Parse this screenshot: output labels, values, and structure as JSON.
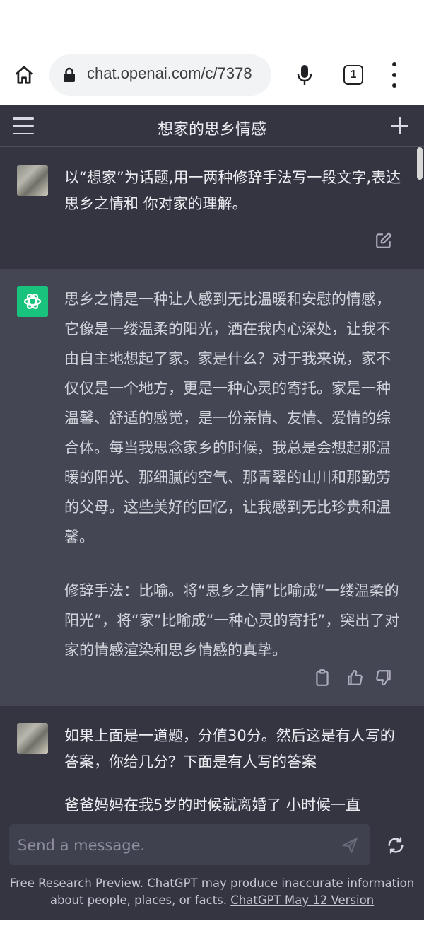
{
  "browser": {
    "url": "chat.openai.com/c/7378",
    "tab_count": "1"
  },
  "header": {
    "title": "想家的思乡情感"
  },
  "messages": [
    {
      "role": "user",
      "text": "以“想家”为话题,用一两种修辞手法写一段文字,表达思乡之情和 你对家的理解。"
    },
    {
      "role": "assistant",
      "paragraph1": "思乡之情是一种让人感到无比温暖和安慰的情感，它像是一缕温柔的阳光，洒在我内心深处，让我不由自主地想起了家。家是什么？对于我来说，家不仅仅是一个地方，更是一种心灵的寄托。家是一种温馨、舒适的感觉，是一份亲情、友情、爱情的综合体。每当我思念家乡的时候，我总是会想起那温暖的阳光、那细腻的空气、那青翠的山川和那勤劳的父母。这些美好的回忆，让我感到无比珍贵和温馨。",
      "paragraph2": "修辞手法：比喻。将“思乡之情”比喻成“一缕温柔的阳光”，将“家”比喻成“一种心灵的寄托”，突出了对家的情感渲染和思乡情感的真挚。"
    },
    {
      "role": "user",
      "text": "如果上面是一道题，分值30分。然后这是有人写的答案，你给几分？下面是有人写的答案",
      "text_cut": "爸爸妈妈在我5岁的时候就离婚了 小时候一直"
    }
  ],
  "composer": {
    "placeholder": "Send a message."
  },
  "footer": {
    "disclaimer": "Free Research Preview. ChatGPT may produce inaccurate information about people, places, or facts.",
    "version_link": "ChatGPT May 12 Version"
  },
  "colors": {
    "app_bg": "#343541",
    "bot_bg": "#444654",
    "accent": "#19c37d"
  }
}
